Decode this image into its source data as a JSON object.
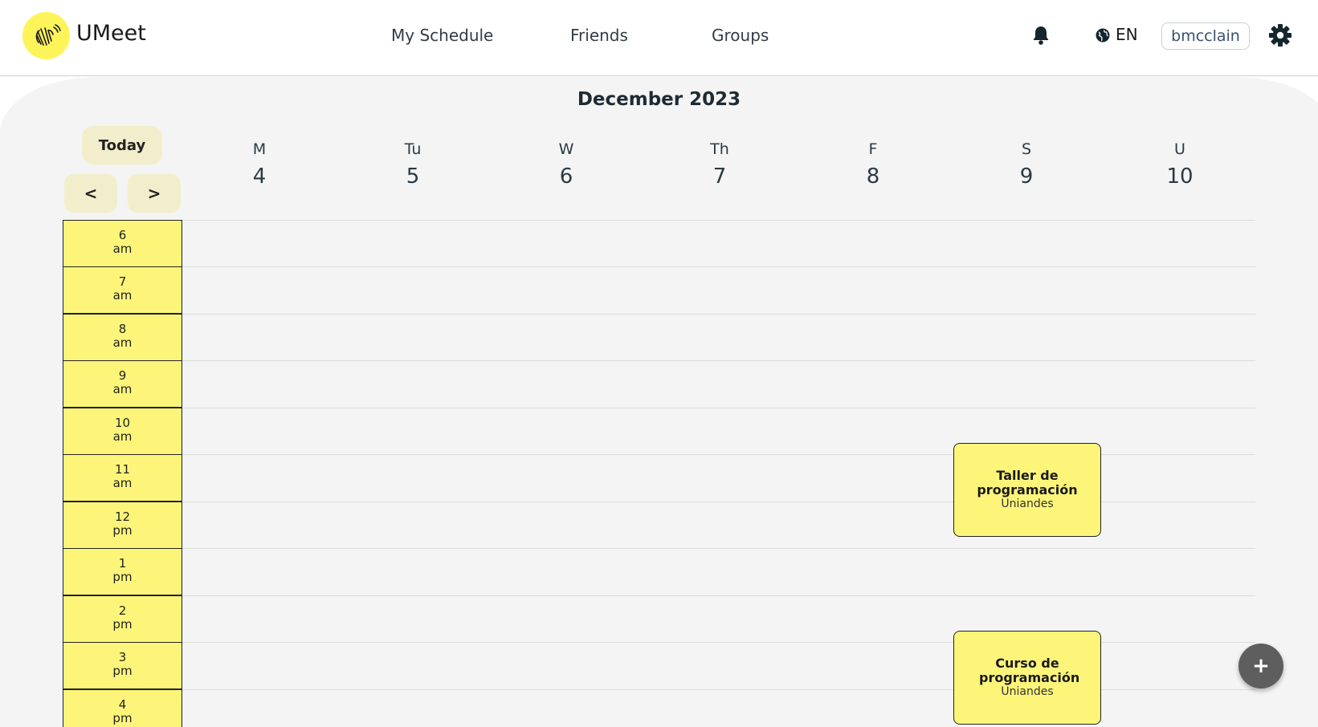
{
  "app": {
    "name": "UMeet",
    "brand_color": "#fdf45a"
  },
  "nav": {
    "schedule": "My Schedule",
    "friends": "Friends",
    "groups": "Groups"
  },
  "header": {
    "language": "EN",
    "username": "bmcclain"
  },
  "calendar": {
    "month_title": "December 2023",
    "today_label": "Today",
    "prev_label": "<",
    "next_label": ">",
    "days": [
      {
        "letter": "M",
        "num": "4"
      },
      {
        "letter": "Tu",
        "num": "5"
      },
      {
        "letter": "W",
        "num": "6"
      },
      {
        "letter": "Th",
        "num": "7"
      },
      {
        "letter": "F",
        "num": "8"
      },
      {
        "letter": "S",
        "num": "9"
      },
      {
        "letter": "U",
        "num": "10"
      }
    ],
    "hours": [
      {
        "h": "6",
        "p": "am"
      },
      {
        "h": "7",
        "p": "am"
      },
      {
        "h": "8",
        "p": "am"
      },
      {
        "h": "9",
        "p": "am"
      },
      {
        "h": "10",
        "p": "am"
      },
      {
        "h": "11",
        "p": "am"
      },
      {
        "h": "12",
        "p": "pm"
      },
      {
        "h": "1",
        "p": "pm"
      },
      {
        "h": "2",
        "p": "pm"
      },
      {
        "h": "3",
        "p": "pm"
      },
      {
        "h": "4",
        "p": "pm"
      }
    ],
    "events": [
      {
        "title": "Taller de programación",
        "subtitle": "Uniandes"
      },
      {
        "title": "Curso de programación",
        "subtitle": "Uniandes"
      }
    ]
  },
  "fab_label": "+"
}
